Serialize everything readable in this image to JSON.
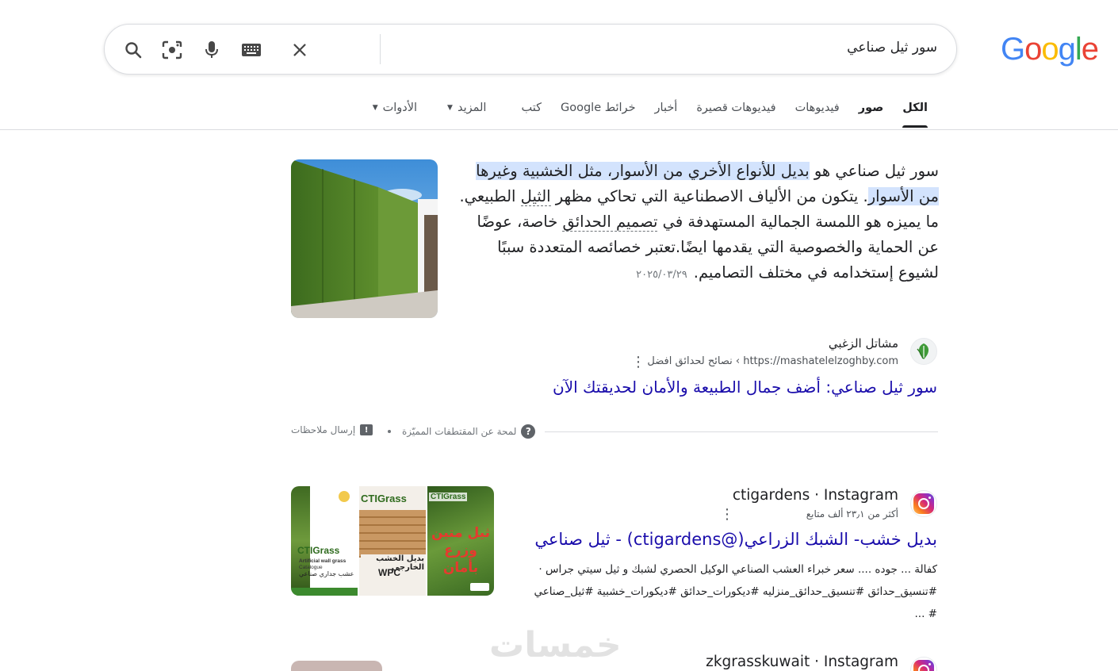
{
  "logo": "Google",
  "search": {
    "query": "سور ثيل صناعي"
  },
  "icons": {
    "clear": "close-icon",
    "keyboard": "keyboard-icon",
    "voice": "microphone-icon",
    "lens": "camera-lens-icon",
    "search": "search-icon"
  },
  "tabs": [
    {
      "label": "الكل",
      "active": true
    },
    {
      "label": "صور",
      "bold": true
    },
    {
      "label": "فيديوهات"
    },
    {
      "label": "فيديوهات قصيرة"
    },
    {
      "label": "أخبار"
    },
    {
      "label": "خرائط Google"
    },
    {
      "label": "كتب"
    },
    {
      "label": "المزيد",
      "dropdown": true
    },
    {
      "label": "الأدوات",
      "dropdown": true
    }
  ],
  "featured": {
    "text_before": "سور ثيل صناعي هو ",
    "highlight": "بديل للأنواع الأخري من الأسوار، مثل الخشبية وغيرها من الأسوار",
    "text_mid1": ". يتكون من الألياف الاصطناعية التي تحاكي مظهر ",
    "link1": "الثيل",
    "text_mid2": " الطبيعي. ما يميزه هو اللمسة الجمالية المستهدفة في ",
    "link2": "تصميم الحدائق",
    "text_end": " خاصة، عوضًا عن الحماية والخصوصية التي يقدمها ايضًا.تعتبر خصائصه المتعددة سببًا لشيوع إستخدامه في مختلف التصاميم.",
    "date": "٢٠٢٥/٠٣/٢٩",
    "source_name": "مشاتل الزغبي",
    "source_url": "https://mashatelelzoghby.com",
    "source_path": "› نصائح لحدائق افضل",
    "result_title": "سور ثيل صناعي: أضف جمال الطبيعة والأمان لحديقتك الآن"
  },
  "feedback": {
    "about": "لمحة عن المقتطفات المميّزة",
    "send": "إرسال ملاحظات"
  },
  "results": [
    {
      "source": "ctigardens · Instagram",
      "meta": "أكثر من ٢٣٫١ ألف متابع",
      "title": "بديل خشب- الشبك الزراعي(@ctigardens) - ثيل صناعي",
      "desc_line1": "كفالة ... جوده .... سعر خبراء العشب الصناعي الوكيل الحصري لشبك و ثيل سيتي جراس ·",
      "desc_line2": "#تنسيق_حدائق #تنسيق_حدائق_منزليه #ديكورات_حدائق #ديكورات_خشبية #ثيل_صناعي",
      "desc_line3": "# ...",
      "thumb1_brand": "CTIGrass",
      "thumb1_sub": "Artificial wall grass",
      "thumb1_sub2": "Catalogue",
      "thumb1_ar": "عشب جداري صناعي",
      "thumb2_brand": "CTIGrass",
      "thumb2_ar": "بديل الخشب الخارجي",
      "thumb2_code": "WPC",
      "thumb3_brand": "CTIGrass",
      "thumb3_ar": "ثيل متين وزرع بأمان"
    },
    {
      "source": "zkgrasskuwait · Instagram"
    }
  ],
  "watermark": "خمسات",
  "colors": {
    "link": "#1a0dab",
    "highlight": "#d3e3fd",
    "text": "#202124",
    "secondary": "#4d5156"
  }
}
